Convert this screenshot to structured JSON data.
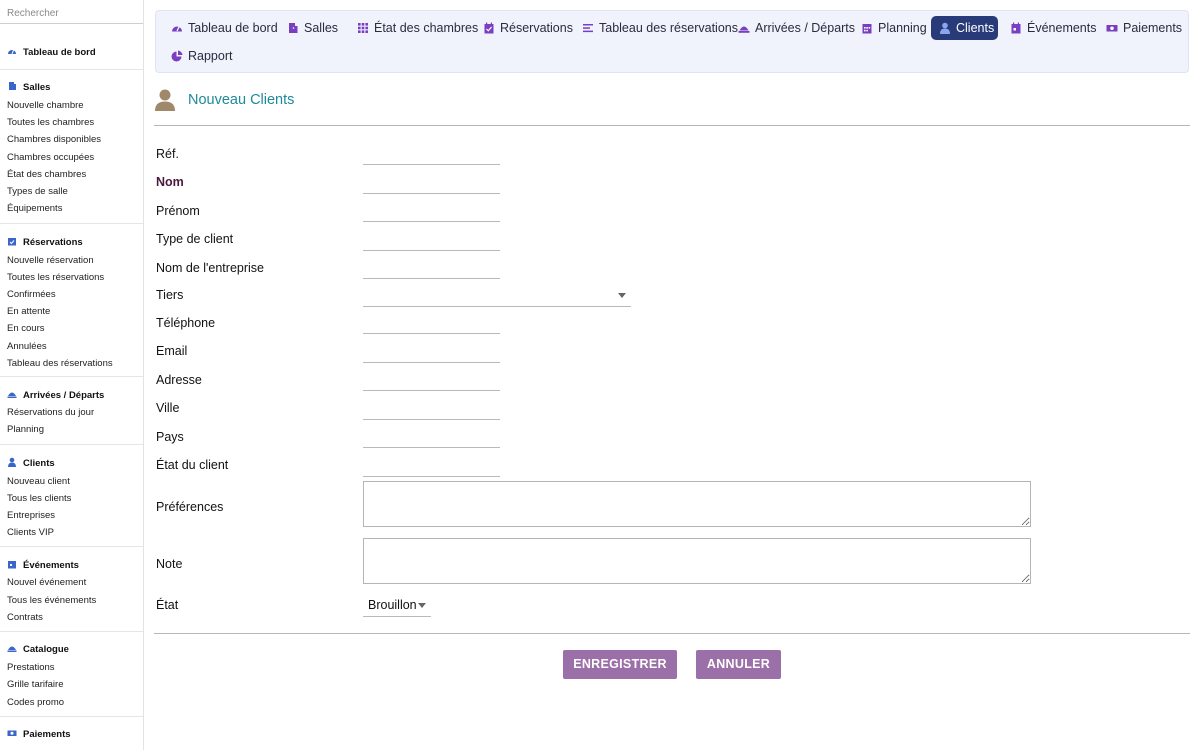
{
  "search": {
    "placeholder": "Rechercher"
  },
  "sidebar": {
    "dashboard": "Tableau de bord",
    "groups": [
      {
        "title": "Salles",
        "items": [
          "Nouvelle chambre",
          "Toutes les chambres",
          "Chambres disponibles",
          "Chambres occupées",
          "État des chambres",
          "Types de salle",
          "Équipements"
        ]
      },
      {
        "title": "Réservations",
        "items": [
          "Nouvelle réservation",
          "Toutes les réservations",
          "Confirmées",
          "En attente",
          "En cours",
          "Annulées",
          "Tableau des réservations"
        ]
      },
      {
        "title": "Arrivées / Départs",
        "items": [
          "Réservations du jour",
          "Planning"
        ]
      },
      {
        "title": "Clients",
        "items": [
          "Nouveau client",
          "Tous les clients",
          "Entreprises",
          "Clients VIP"
        ]
      },
      {
        "title": "Événements",
        "items": [
          "Nouvel événement",
          "Tous les événements",
          "Contrats"
        ]
      },
      {
        "title": "Catalogue",
        "items": [
          "Prestations",
          "Grille tarifaire",
          "Codes promo"
        ]
      },
      {
        "title": "Paiements",
        "items": []
      }
    ]
  },
  "topmenu": {
    "tabs": [
      "Tableau de bord",
      "Salles",
      "État des chambres",
      "Réservations",
      "Tableau des réservations",
      "Arrivées / Départs",
      "Planning",
      "Clients",
      "Événements",
      "Paiements",
      "Rapport"
    ],
    "active": "Clients"
  },
  "page": {
    "title": "Nouveau Clients"
  },
  "form": {
    "labels": {
      "ref": "Réf.",
      "nom": "Nom",
      "prenom": "Prénom",
      "type_client": "Type de client",
      "entreprise": "Nom de l'entreprise",
      "tiers": "Tiers",
      "telephone": "Téléphone",
      "email": "Email",
      "adresse": "Adresse",
      "ville": "Ville",
      "pays": "Pays",
      "etat_client": "État du client",
      "preferences": "Préférences",
      "note": "Note",
      "etat": "État"
    },
    "etat_value": "Brouillon",
    "save_label": "ENREGISTRER",
    "cancel_label": "ANNULER"
  },
  "colors": {
    "accent": "#283b78",
    "title": "#1e8a9a",
    "button": "#9b6fa7",
    "icon": "#7a3fc0",
    "sidebar_icon": "#3b66c9"
  }
}
